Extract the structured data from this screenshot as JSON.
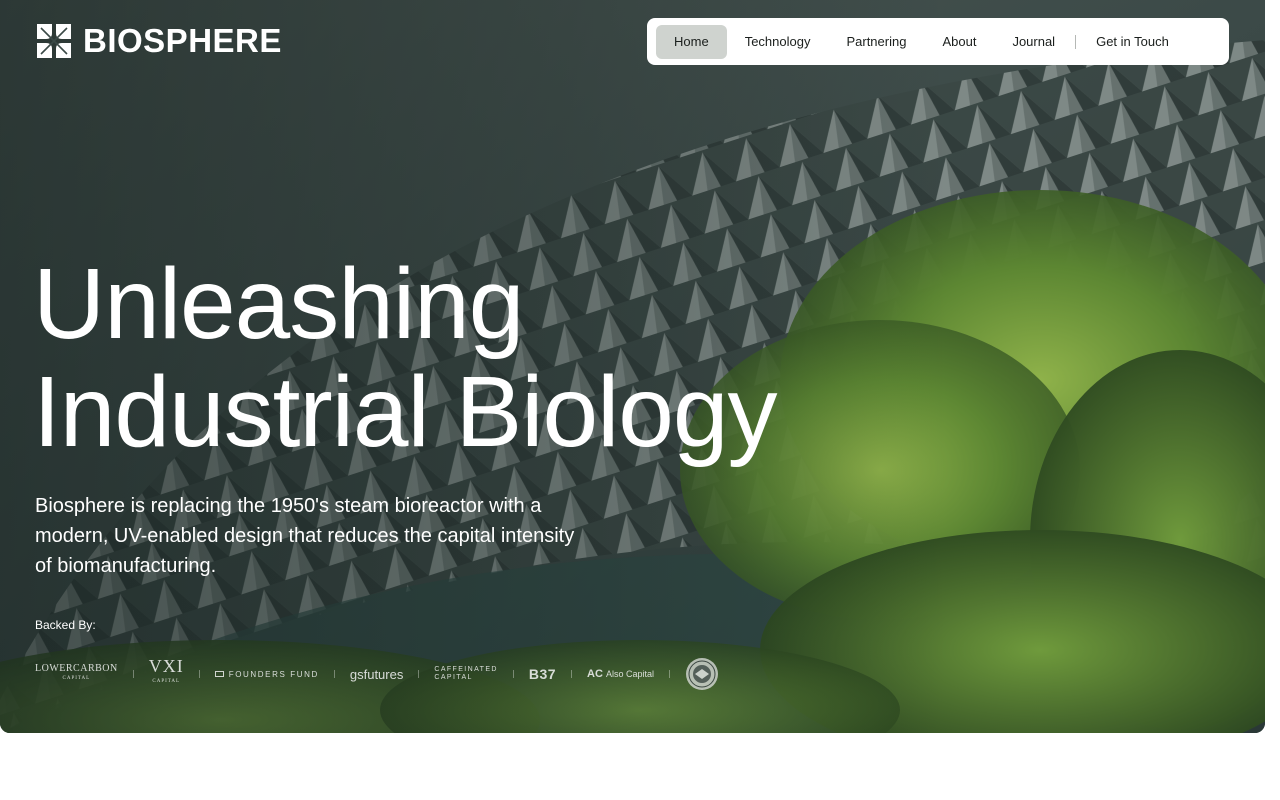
{
  "brand": {
    "name": "BIOSPHERE",
    "logo_icon": "biosphere-logo-icon"
  },
  "nav": {
    "items": [
      {
        "label": "Home",
        "active": true
      },
      {
        "label": "Technology",
        "active": false
      },
      {
        "label": "Partnering",
        "active": false
      },
      {
        "label": "About",
        "active": false
      },
      {
        "label": "Journal",
        "active": false
      }
    ],
    "cta_label": "Get in Touch"
  },
  "hero": {
    "headline_line1": "Unleashing",
    "headline_line2": "Industrial Biology",
    "subtext": "Biosphere is replacing the 1950's steam bioreactor with a modern, UV-enabled design that reduces the capital intensity of biomanufacturing.",
    "background": "architectural-canopy-and-trees-photo"
  },
  "backers": {
    "label": "Backed By:",
    "logos": {
      "lowercarbon": {
        "name": "LOWERCARBON",
        "sub": "CAPITAL"
      },
      "vxi": {
        "name": "VXI",
        "sub": "CAPITAL"
      },
      "founders_fund": {
        "name": "FOUNDERS FUND"
      },
      "gsfutures": {
        "name": "gsfutures"
      },
      "caffeinated": {
        "line1": "CAFFEINATED",
        "line2": "CAPITAL"
      },
      "b37": {
        "name": "B37"
      },
      "also_capital": {
        "mark": "AC",
        "name": "Also Capital"
      },
      "seal": {
        "icon": "government-seal-icon"
      }
    }
  },
  "colors": {
    "nav_bg": "#ffffff",
    "nav_active": "#cfd3cf",
    "nav_text": "#1b1f1d",
    "hero_text": "#ffffff",
    "foliage": "#5f8a3a"
  }
}
